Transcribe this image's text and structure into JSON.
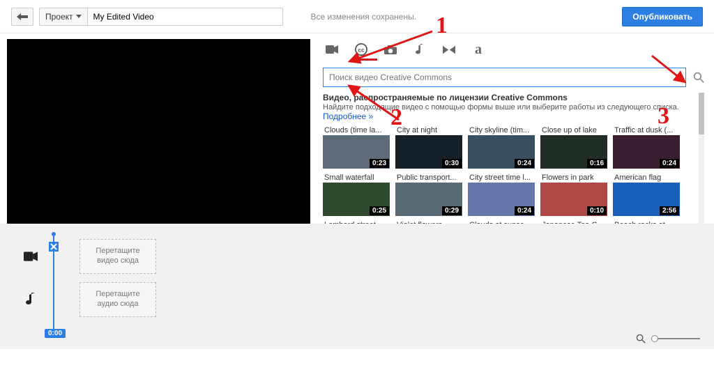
{
  "topbar": {
    "project_label": "Проект",
    "title_value": "My Edited Video",
    "save_status": "Все изменения сохранены.",
    "publish_label": "Опубликовать"
  },
  "tabs": {
    "items": [
      "camera",
      "cc",
      "photo",
      "music",
      "transition",
      "text"
    ],
    "active_index": 1
  },
  "search": {
    "placeholder": "Поиск видео Creative Commons"
  },
  "library": {
    "header": "Видео, распространяемые по лицензии Creative Commons",
    "subtext": "Найдите подходящие видео с помощью формы выше или выберите работы из следующего списка.",
    "more_label": "Подробнее »",
    "row1": [
      {
        "title": "Clouds (time la...",
        "duration": "0:23",
        "bg": "#5e6b7a"
      },
      {
        "title": "City at night",
        "duration": "0:30",
        "bg": "#16202b"
      },
      {
        "title": "City skyline (tim...",
        "duration": "0:24",
        "bg": "#3a5061"
      },
      {
        "title": "Close up of lake",
        "duration": "0:16",
        "bg": "#1f2f25"
      },
      {
        "title": "Traffic at dusk (...",
        "duration": "0:24",
        "bg": "#3a1f30"
      }
    ],
    "row2": [
      {
        "title": "Small waterfall",
        "duration": "0:25",
        "bg": "#2f4a2d"
      },
      {
        "title": "Public transport...",
        "duration": "0:29",
        "bg": "#596a74"
      },
      {
        "title": "City street time l...",
        "duration": "0:24",
        "bg": "#6677aa"
      },
      {
        "title": "Flowers in park",
        "duration": "0:10",
        "bg": "#b04848"
      },
      {
        "title": "American flag",
        "duration": "2:56",
        "bg": "#1b5fbd"
      }
    ],
    "row3": [
      {
        "title": "Lombard street",
        "duration": "",
        "bg": "#888"
      },
      {
        "title": "Violet flowers",
        "duration": "",
        "bg": "#888"
      },
      {
        "title": "Clouds at sunse...",
        "duration": "",
        "bg": "#888"
      },
      {
        "title": "Japanese Tea G...",
        "duration": "",
        "bg": "#888"
      },
      {
        "title": "Beach rocks at ...",
        "duration": "",
        "bg": "#888"
      }
    ]
  },
  "timeline": {
    "video_drop": "Перетащите\nвидео сюда",
    "audio_drop": "Перетащите\nаудио сюда",
    "playhead_time": "0:00"
  },
  "annotations": {
    "n1": "1",
    "n2": "2",
    "n3": "3"
  }
}
